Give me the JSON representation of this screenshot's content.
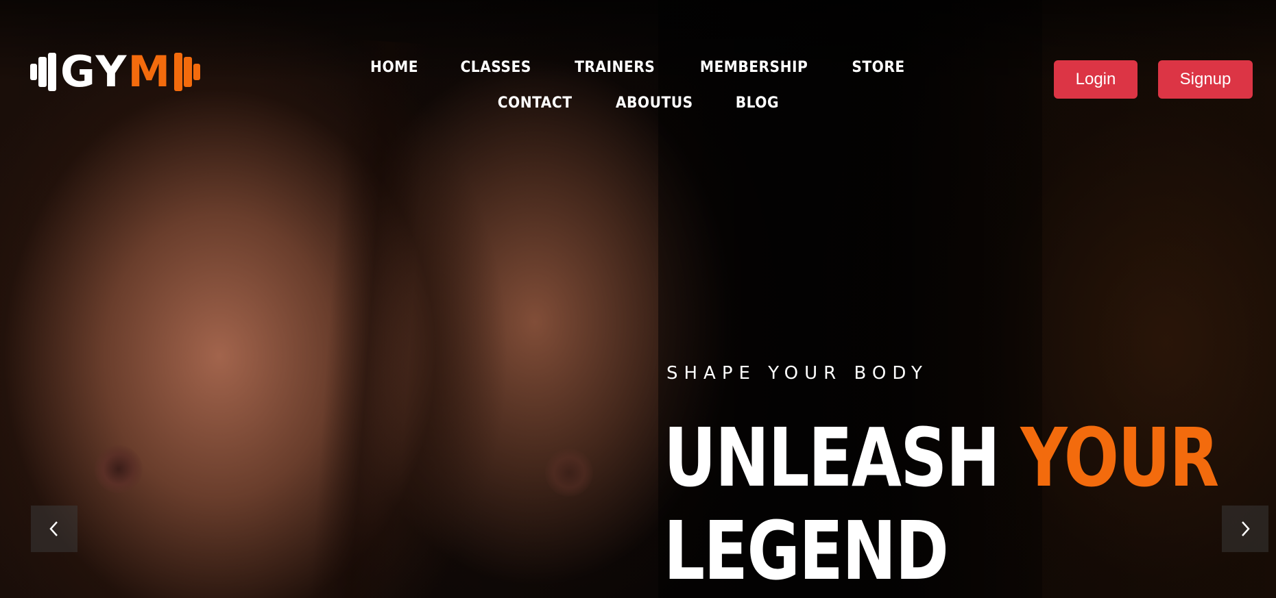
{
  "brand": {
    "logo_part1": "GY",
    "logo_part2": "M",
    "primary_color": "#ffffff",
    "accent_color": "#f36b0d",
    "icon": "dumbbell-icon"
  },
  "nav": {
    "items": [
      {
        "label": "HOME"
      },
      {
        "label": "CLASSES"
      },
      {
        "label": "TRAINERS"
      },
      {
        "label": "MEMBERSHIP"
      },
      {
        "label": "STORE"
      },
      {
        "label": "CONTACT"
      },
      {
        "label": "ABOUTUS"
      },
      {
        "label": "BLOG"
      }
    ]
  },
  "auth": {
    "login_label": "Login",
    "signup_label": "Signup",
    "button_color": "#dc3545"
  },
  "hero": {
    "kicker": "SHAPE YOUR BODY",
    "headline_part1": "UNLEASH ",
    "headline_accent": "YOUR",
    "headline_part2": "LEGEND"
  },
  "carousel": {
    "prev_icon": "chevron-left-icon",
    "next_icon": "chevron-right-icon"
  }
}
